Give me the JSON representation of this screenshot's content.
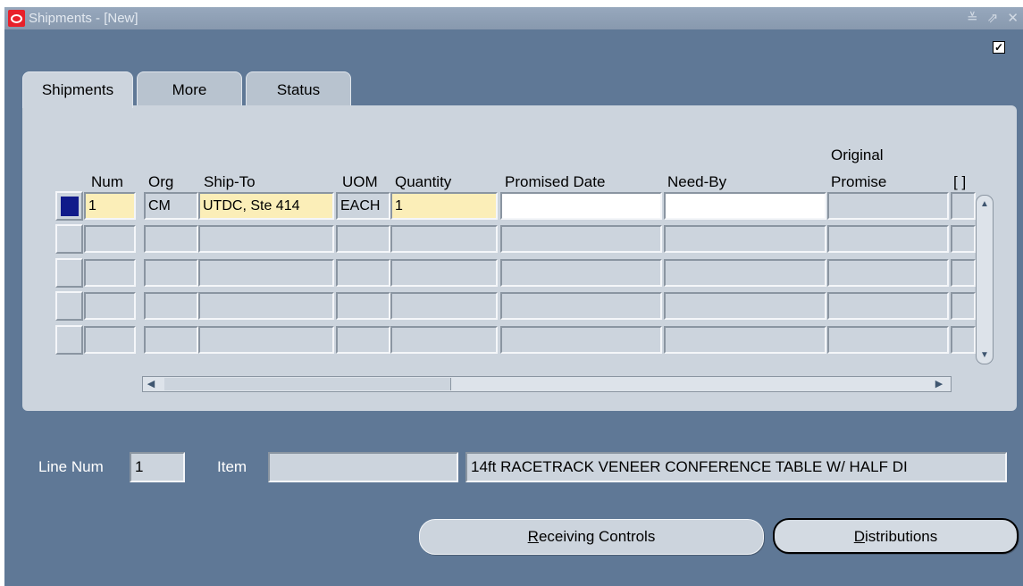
{
  "window": {
    "title": "Shipments - [New]",
    "controls": "≚ ⇗ ✕",
    "corner_checkbox_checked": true
  },
  "tabs": [
    {
      "label": "Shipments",
      "active": true
    },
    {
      "label": "More",
      "active": false
    },
    {
      "label": "Status",
      "active": false
    }
  ],
  "grid": {
    "headers": {
      "num": "Num",
      "org": "Org",
      "ship_to": "Ship-To",
      "uom": "UOM",
      "quantity": "Quantity",
      "promised_date": "Promised Date",
      "need_by": "Need-By",
      "original_promise_line1": "Original",
      "original_promise_line2": "Promise",
      "flex": "[ ]"
    },
    "rows": [
      {
        "num": "1",
        "org": "CM",
        "ship_to": "UTDC, Ste 414",
        "uom": "EACH",
        "quantity": "1",
        "promised_date": "",
        "need_by": "",
        "original_promise": "",
        "flex": ""
      },
      {
        "num": "",
        "org": "",
        "ship_to": "",
        "uom": "",
        "quantity": "",
        "promised_date": "",
        "need_by": "",
        "original_promise": "",
        "flex": ""
      },
      {
        "num": "",
        "org": "",
        "ship_to": "",
        "uom": "",
        "quantity": "",
        "promised_date": "",
        "need_by": "",
        "original_promise": "",
        "flex": ""
      },
      {
        "num": "",
        "org": "",
        "ship_to": "",
        "uom": "",
        "quantity": "",
        "promised_date": "",
        "need_by": "",
        "original_promise": "",
        "flex": ""
      },
      {
        "num": "",
        "org": "",
        "ship_to": "",
        "uom": "",
        "quantity": "",
        "promised_date": "",
        "need_by": "",
        "original_promise": "",
        "flex": ""
      }
    ]
  },
  "footer": {
    "line_num_label": "Line Num",
    "line_num_value": "1",
    "item_label": "Item",
    "item_value": "",
    "item_description": "14ft RACETRACK VENEER CONFERENCE TABLE W/ HALF DI"
  },
  "buttons": {
    "receiving_controls": {
      "mnemonic": "R",
      "rest": "eceiving Controls"
    },
    "distributions": {
      "mnemonic": "D",
      "rest": "istributions"
    }
  },
  "colors": {
    "window_bg": "#5f7896",
    "panel_bg": "#ccd4dd",
    "required_field": "#fbeeb8",
    "current_record_marker": "#101a8a",
    "oracle_icon": "#e8202a"
  }
}
